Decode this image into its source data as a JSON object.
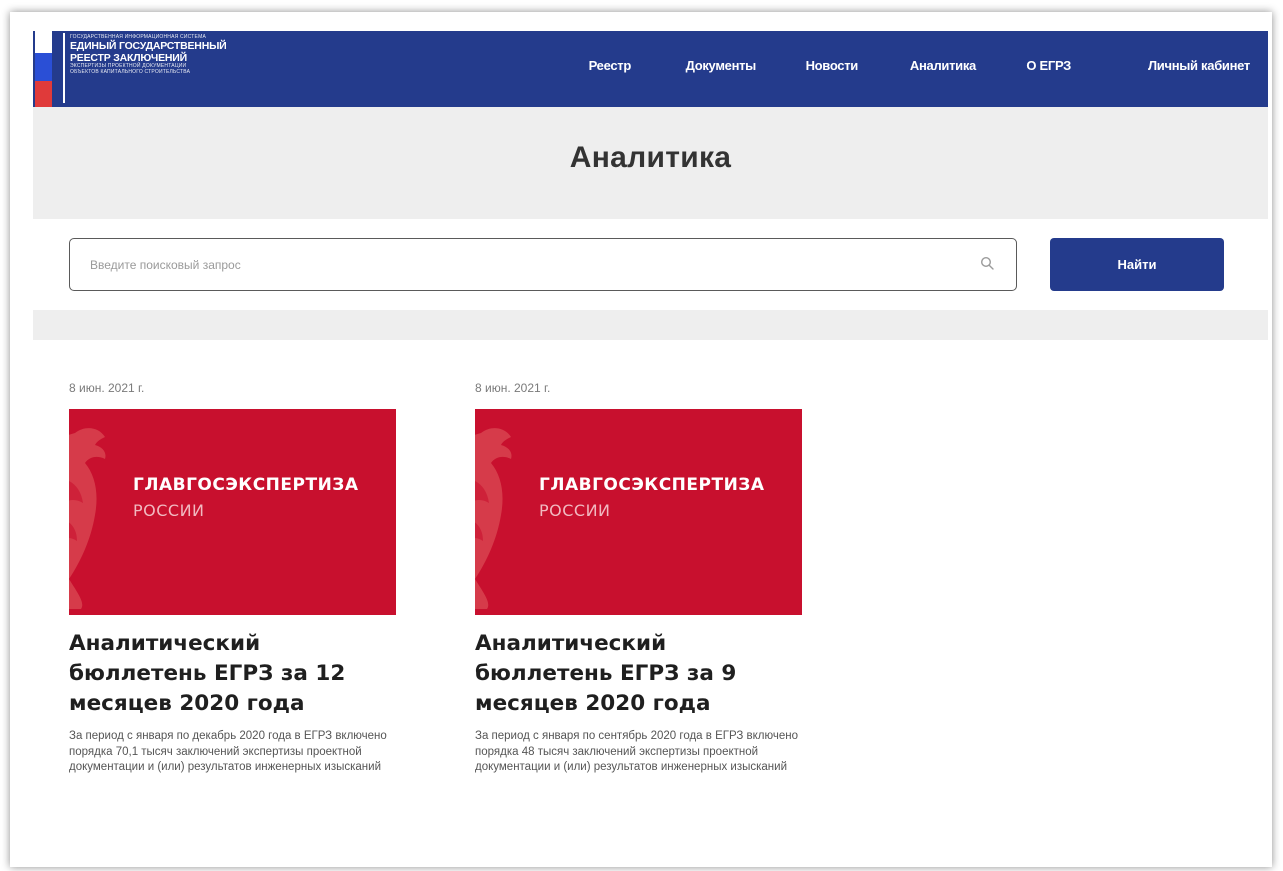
{
  "header": {
    "logo": {
      "line1": "государственная информационная система",
      "line2": "единый государственный",
      "line3": "реестр заключений",
      "line4": "экспертизы проектной документации",
      "line5": "объектов капитального строительства"
    },
    "nav": [
      "Реестр",
      "Документы",
      "Новости",
      "Аналитика",
      "О ЕГРЗ",
      "Личный кабинет"
    ]
  },
  "page_title": "Аналитика",
  "search": {
    "placeholder": "Введите поисковый запрос",
    "button_label": "Найти"
  },
  "cards": [
    {
      "date": "8 июн. 2021 г.",
      "image_brand_1": "ГЛАВГОСЭКСПЕРТИЗА",
      "image_brand_2": "РОССИИ",
      "title": "Аналитический бюллетень ЕГРЗ за 12 месяцев 2020 года",
      "text": "За период с января по декабрь 2020 года в ЕГРЗ включено порядка 70,1 тысяч заключений экспертизы проектной документации и (или) результатов инженерных изысканий"
    },
    {
      "date": "8 июн. 2021 г.",
      "image_brand_1": "ГЛАВГОСЭКСПЕРТИЗА",
      "image_brand_2": "РОССИИ",
      "title": "Аналитический бюллетень ЕГРЗ за 9 месяцев 2020 года",
      "text": "За период с января по сентябрь 2020 года в ЕГРЗ включено порядка 48 тысяч заключений экспертизы проектной документации и (или) результатов инженерных изысканий"
    }
  ],
  "colors": {
    "header_bg": "#243b8c",
    "card_image_bg": "#c8102e",
    "title_band_bg": "#eeeeee"
  },
  "icons": {
    "search": "search-icon",
    "emblem": "eagle-emblem-icon",
    "flag": "russian-flag-icon"
  }
}
